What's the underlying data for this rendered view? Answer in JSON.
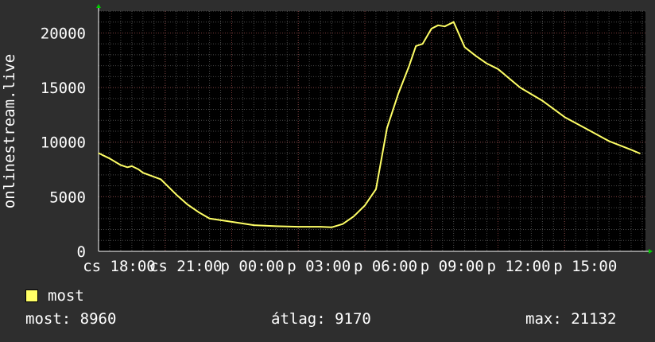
{
  "colors": {
    "background": "#2e2e2e",
    "plot_bg": "#000000",
    "grid": "#4a4a4a",
    "grid_major": "#7a3a3a",
    "line": "#ffff66",
    "axis_arrow": "#00cc00"
  },
  "legend": {
    "label": "most",
    "color": "#ffff66"
  },
  "stats": [
    {
      "label": "most:",
      "value": "8960"
    },
    {
      "label": "átlag:",
      "value": "9170"
    },
    {
      "label": "max:",
      "value": "21132"
    }
  ],
  "chart_data": {
    "type": "line",
    "ylabel": "onlinestream.live",
    "xlabel": "",
    "title": "",
    "ylim": [
      0,
      22000
    ],
    "xlim": [
      0,
      24.5
    ],
    "yticks": [
      0,
      5000,
      10000,
      15000,
      20000
    ],
    "xticks": [
      {
        "x": 0,
        "label": "cs 18:00"
      },
      {
        "x": 3,
        "label": "cs 21:00"
      },
      {
        "x": 6,
        "label": "p 00:00"
      },
      {
        "x": 9,
        "label": "p 03:00"
      },
      {
        "x": 12,
        "label": "p 06:00"
      },
      {
        "x": 15,
        "label": "p 09:00"
      },
      {
        "x": 18,
        "label": "p 12:00"
      },
      {
        "x": 21,
        "label": "p 15:00"
      }
    ],
    "grid": true,
    "legend_position": "bottom-left",
    "series": [
      {
        "name": "most",
        "x": [
          0,
          0.5,
          1.0,
          1.3,
          1.5,
          1.8,
          2.0,
          2.4,
          2.8,
          3.0,
          3.5,
          4.0,
          4.5,
          5.0,
          6.0,
          7.0,
          8.0,
          9.0,
          10.0,
          10.5,
          11.0,
          11.5,
          12.0,
          12.5,
          13.0,
          13.5,
          14.0,
          14.3,
          14.6,
          15.0,
          15.3,
          15.6,
          16.0,
          16.5,
          17.0,
          17.5,
          18.0,
          19.0,
          20.0,
          21.0,
          22.0,
          23.0,
          24.0,
          24.4
        ],
        "values": [
          9000,
          8500,
          7900,
          7700,
          7800,
          7500,
          7200,
          6900,
          6600,
          6200,
          5200,
          4300,
          3600,
          3000,
          2700,
          2400,
          2300,
          2250,
          2250,
          2200,
          2500,
          3200,
          4200,
          5700,
          11300,
          14400,
          17000,
          18800,
          19000,
          20400,
          20700,
          20600,
          21000,
          18700,
          17900,
          17200,
          16700,
          15000,
          13800,
          12300,
          11200,
          10100,
          9300,
          8960
        ]
      }
    ]
  }
}
